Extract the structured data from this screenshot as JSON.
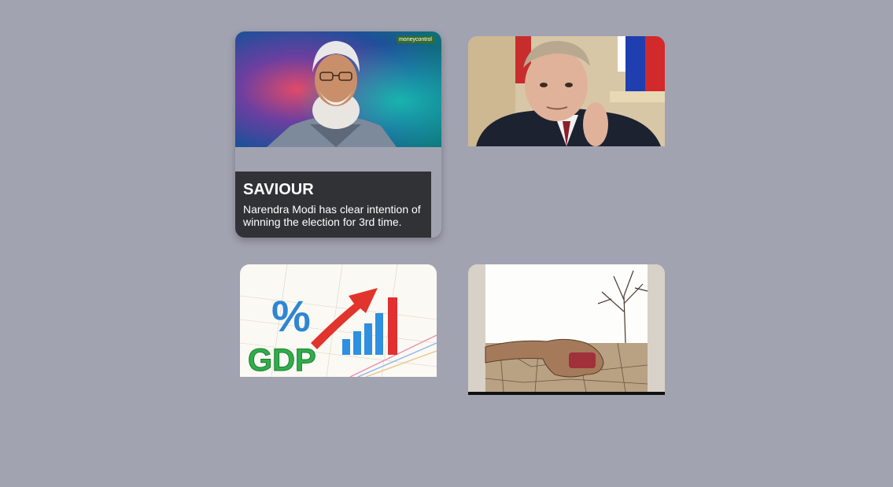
{
  "cards": [
    {
      "image_name": "modi-portrait-image",
      "watermark": "moneycontrol",
      "title": "SAVIOUR",
      "description": "Narendra Modi has clear intention of winning the election for 3rd time."
    },
    {
      "image_name": "putin-portrait-image"
    },
    {
      "image_name": "gdp-growth-chart-image",
      "overlay_text": "GDP"
    },
    {
      "image_name": "drought-hand-image"
    }
  ],
  "colors": {
    "page_background": "#a2a3b1",
    "caption_background": "#313236",
    "caption_text": "#ffffff"
  }
}
